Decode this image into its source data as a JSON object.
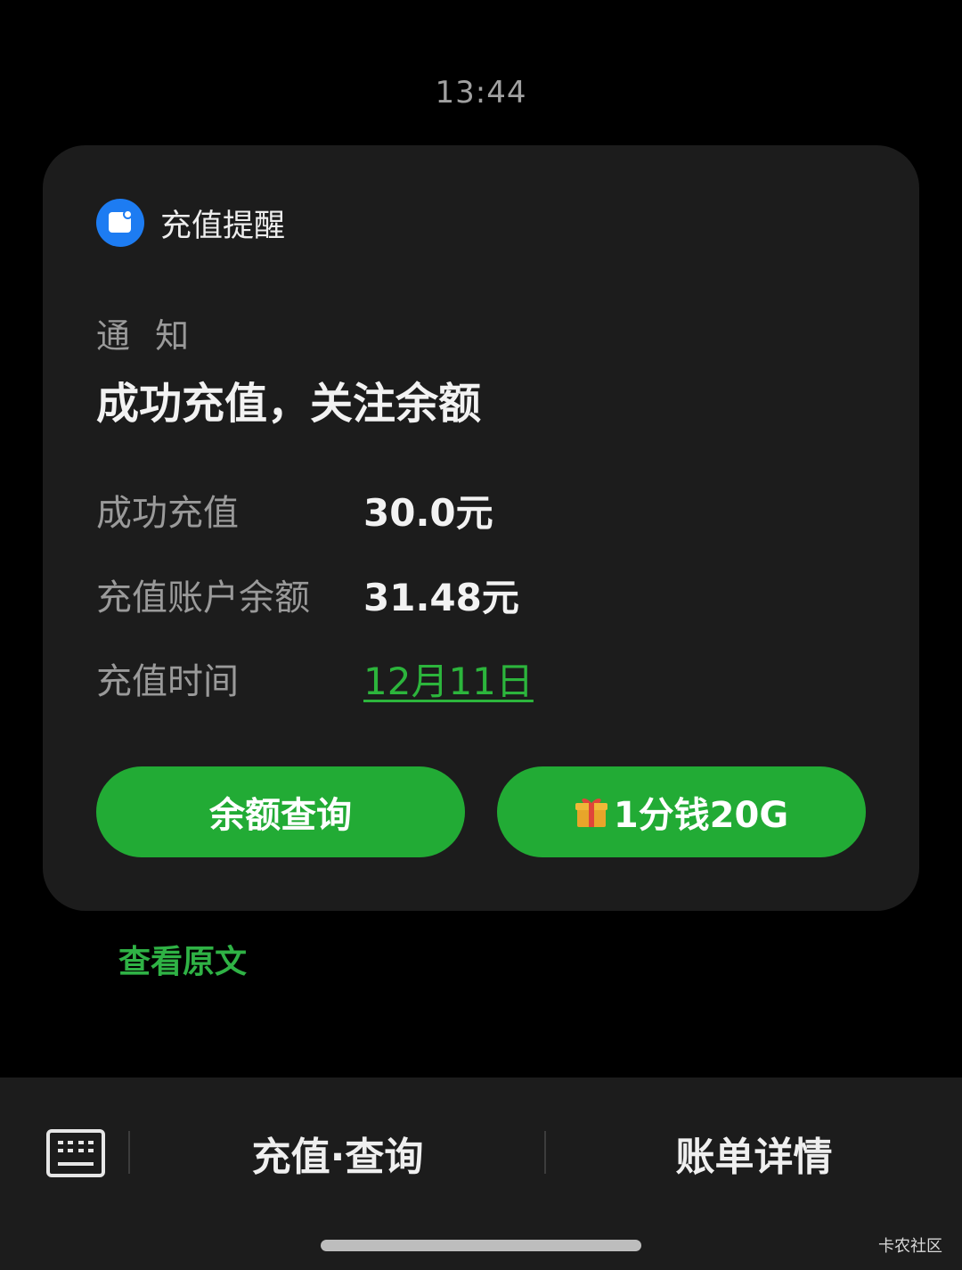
{
  "status": {
    "time": "13:44"
  },
  "notification": {
    "app_name": "充值提醒",
    "type": "通 知",
    "title": "成功充值，关注余额",
    "rows": [
      {
        "label": "成功充值",
        "value": "30.0元"
      },
      {
        "label": "充值账户余额",
        "value": "31.48元"
      },
      {
        "label": "充值时间",
        "value": "12月11日"
      }
    ],
    "buttons": {
      "balance_query": "余额查询",
      "promo": "1分钱20G"
    }
  },
  "view_original": "查看原文",
  "bottom_menu": {
    "item1": "充值·查询",
    "item2": "账单详情"
  },
  "watermark": "卡农社区",
  "colors": {
    "accent_green": "#22ab35",
    "link_green": "#2cb53c",
    "app_icon_blue": "#1d7cf2"
  }
}
